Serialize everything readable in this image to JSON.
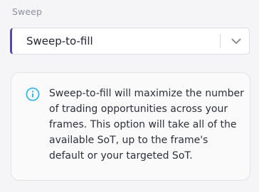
{
  "sweep": {
    "label": "Sweep",
    "selected_value": "Sweep-to-fill",
    "accent_color": "#5b4a97",
    "dropdown_icon": "chevron-down-icon"
  },
  "info": {
    "icon": "info-icon",
    "icon_color": "#3ab6e2",
    "text": "Sweep-to-fill will maximize the number of trading opportunities across your frames. This option will take all of the available SoT, up to the frame's default or your targeted SoT."
  }
}
